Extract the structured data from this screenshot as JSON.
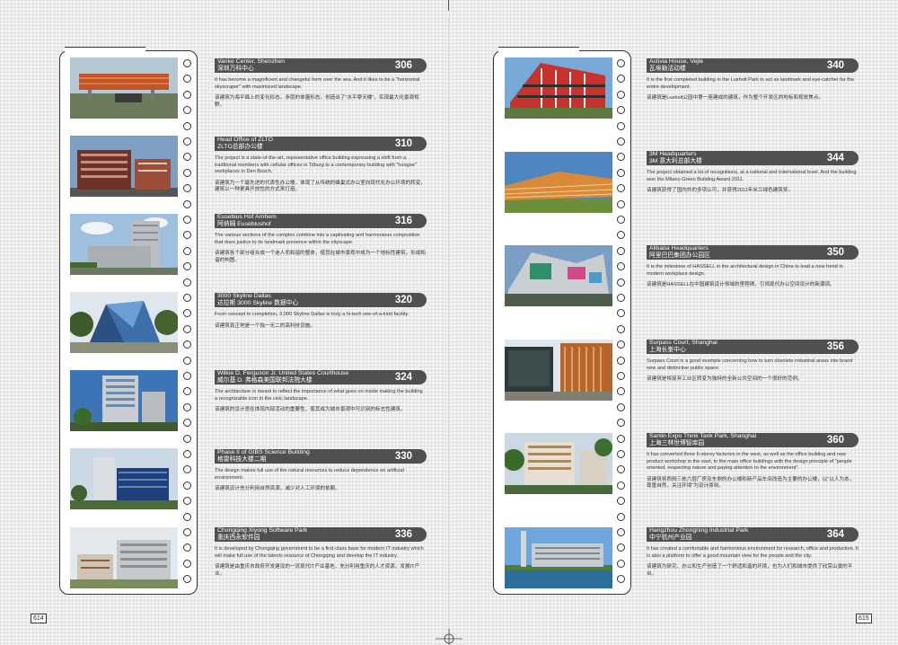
{
  "pages": {
    "left": {
      "folio": "614",
      "entries": [
        {
          "title_en": "Vanke Center, Shenzhen",
          "title_cn": "深圳万科中心",
          "page": "306",
          "desc_en": "It has become a magnificent and changeful form over the sea. And it likes to be a \"horizontal skyscraper\" with maximized landscape.",
          "desc_cn": "该建筑为海平面上的变化形态，多层的体量形态，创造出了\"水平摩天楼\"，实现最大化景观视野。"
        },
        {
          "title_en": "Head Office of ZLTO",
          "title_cn": "ZLTO总部办公楼",
          "page": "310",
          "desc_en": "The project is a state-of-the-art, representative office building expressing a shift from a traditional members with cellular offices in Tilburg to a contemporary building with \"hoogoe\" workplaces in Den Bosch.",
          "desc_cn": "该建筑为一个最先进的代表性办公楼，体现了从传统的蜂巢式办公室向现代化办公环境的转变，建筑以一种更具开放性的方式来打造。"
        },
        {
          "title_en": "Eusebius Hof Arnhem",
          "title_cn": "阿纳姆 Eusebiushof",
          "page": "316",
          "desc_en": "The various sections of the complex combine into a captivating and harmonious composition that does justice to its landmark presence within the cityscape.",
          "desc_cn": "该建筑各个部分组合成一个迷人而和谐的整体，使其在城市景观中成为一个地标性建筑，形成和谐的构图。"
        },
        {
          "title_en": "3000 Skyline Dallas",
          "title_cn": "达拉斯 3000 Skyline 数据中心",
          "page": "320",
          "desc_en": "From concept to completion, 3,000 Skyline Dallas is truly a hi-tech one-of-a-kind facility.",
          "desc_cn": "该建筑真正地是一个独一无二的高科技设施。"
        },
        {
          "title_en": "Wilkie D. Ferguson Jr. United States Courthouse",
          "title_cn": "威尔基 D. 弗格森美国联邦法院大楼",
          "page": "324",
          "desc_en": "The architecture is meant to reflect the importance of what goes on inside making the building a recognizable icon in the civic landscape.",
          "desc_cn": "该建筑的设计意在体现内部活动的重要性，使其成为城市景观中可识别的标志性建筑。"
        },
        {
          "title_en": "Phase II of GIBS Science Building",
          "title_cn": "格雷科技大楼二期",
          "page": "330",
          "desc_en": "The design makes full use of the natural resources to reduce dependence on artificial environment.",
          "desc_cn": "该建筑设计充分利用自然资源，减少对人工环境的依赖。"
        },
        {
          "title_en": "Chongqing Xiyong Software Park",
          "title_cn": "重庆西永软件园",
          "page": "336",
          "desc_en": "It is developed by Chongqing government to be a first-class base for modern IT industry which will make full use of the talents resource of Chongqing and develop the IT industry.",
          "desc_cn": "该建筑是由重庆市政府开发建设的一流现代IT产业基地，充分利用重庆的人才资源，发展IT产业。"
        }
      ]
    },
    "right": {
      "folio": "615",
      "entries": [
        {
          "title_en": "Activia House, Vejle",
          "title_cn": "瓦埃勒活动楼",
          "page": "340",
          "desc_en": "It is the first completed building in the Lusholt Park to act as landmark and eye-catcher for the entire development.",
          "desc_cn": "该建筑是Lusholt公园中第一座建成的建筑，作为整个开发区的地标和视觉焦点。"
        },
        {
          "title_en": "3M Headquarters",
          "title_cn": "3M 意大利总部大楼",
          "page": "344",
          "desc_en": "The project obtained a lot of recognitions, at a national and international level. And the building won the Milano Green Building Award 2011.",
          "desc_cn": "该建筑获得了国内外的多项认可，并获得2011年米兰绿色建筑奖。"
        },
        {
          "title_en": "Alibaba Headquarters",
          "title_cn": "阿里巴巴集团办公园区",
          "page": "350",
          "desc_en": "It is the milestone of HASSELL in the architectural design in China to lead a new trend in modern workplace design.",
          "desc_cn": "该建筑是HASSELL在中国建筑设计领域的里程碑，引领现代办公空间设计的新潮流。"
        },
        {
          "title_en": "Surpass Court, Shanghai",
          "title_cn": "上海长峯中心",
          "page": "356",
          "desc_en": "Surpass Court is a good example concerning how to turn obsolete industrial areas into brand new and distinctive public space.",
          "desc_cn": "该建筑是将废弃工业区转变为独特的全新公共空间的一个很好的范例。"
        },
        {
          "title_en": "Sanlin Expo Think Tank Park, Shanghai",
          "title_cn": "上海三林世博智库园",
          "page": "360",
          "desc_en": "It has converted three 6-storey factories in the west, as well as the office building and new product workshop in the east, to the main office buildings with the design principle of \"people oriented, respecting nature and paying attention to the environment\".",
          "desc_cn": "该建筑将西侧三栋六层厂房及东侧的办公楼和新产品车间改造为主要的办公楼，以\"以人为本，尊重自然，关注环境\"为设计原则。"
        },
        {
          "title_en": "Hangzhou Zhongning Industrial Park",
          "title_cn": "中宁杭州产业园",
          "page": "364",
          "desc_en": "It has created a comfortable and harmonious environment for research, office and production. It is also a platform to offer a good mountain view for the people and the city.",
          "desc_cn": "该建筑为研究、办公和生产创造了一个舒适和谐的环境，也为人们和城市提供了欣赏山景的平台。"
        }
      ]
    }
  },
  "colors": {
    "title_bar": "#505050",
    "sheet_border": "#333333",
    "page_grid": "#e2e2e2"
  }
}
